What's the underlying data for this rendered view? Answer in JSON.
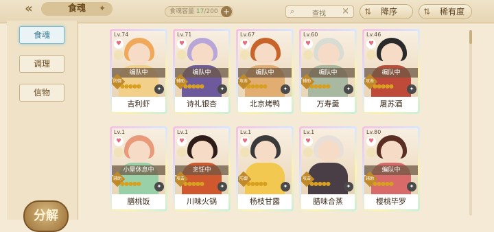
{
  "header": {
    "back_icon": "back-arrow-icon",
    "title": "食魂",
    "star_icon": "star-icon",
    "capacity_label": "食魂容量",
    "capacity_current": "17",
    "capacity_max": "/200",
    "capacity_add_icon": "plus-icon",
    "search_placeholder": "查找",
    "sort_label": "降序",
    "rarity_label": "稀有度"
  },
  "sidebar": {
    "items": [
      {
        "label": "食魂",
        "active": true
      },
      {
        "label": "调理",
        "active": false
      },
      {
        "label": "信物",
        "active": false
      }
    ],
    "decompose_label": "分解"
  },
  "cards": [
    {
      "level": "Lv.74",
      "status": "编队中",
      "name": "吉利虾",
      "role": "防御",
      "hair": "#f0a85a",
      "robe": "#f3d08a"
    },
    {
      "level": "Lv.71",
      "status": "编队中",
      "name": "诗礼银杏",
      "role": "辅助",
      "hair": "#b8a6d8",
      "robe": "#6c5a9c"
    },
    {
      "level": "Lv.67",
      "status": "编队中",
      "name": "北京烤鸭",
      "role": "攻击",
      "hair": "#c8642a",
      "robe": "#e2ad70"
    },
    {
      "level": "Lv.60",
      "status": "编队中",
      "name": "万寿羹",
      "role": "辅助",
      "hair": "#d8dcd2",
      "robe": "#a9b8a0"
    },
    {
      "level": "Lv.46",
      "status": "编队中",
      "name": "屠苏酒",
      "role": "攻击",
      "hair": "#2a2a2a",
      "robe": "#c04a3a"
    },
    {
      "level": "Lv.1",
      "status": "小屋休息中",
      "name": "膳桃饭",
      "role": "辅助",
      "hair": "#e89a7a",
      "robe": "#9ad0a8"
    },
    {
      "level": "Lv.1",
      "status": "烹饪中",
      "name": "川味火锅",
      "role": "攻击",
      "hair": "#2e1c18",
      "robe": "#d0582e"
    },
    {
      "level": "Lv.1",
      "status": "",
      "name": "杨枝甘露",
      "role": "防御",
      "hair": "#3a3a3a",
      "robe": "#f2c850"
    },
    {
      "level": "Lv.1",
      "status": "",
      "name": "腊味合蒸",
      "role": "攻击",
      "hair": "#e8e0d8",
      "robe": "#4a3e46"
    },
    {
      "level": "Lv.80",
      "status": "编队中",
      "name": "樱桃毕罗",
      "role": "辅助",
      "hair": "#5a2e22",
      "robe": "#d86a6a"
    }
  ]
}
